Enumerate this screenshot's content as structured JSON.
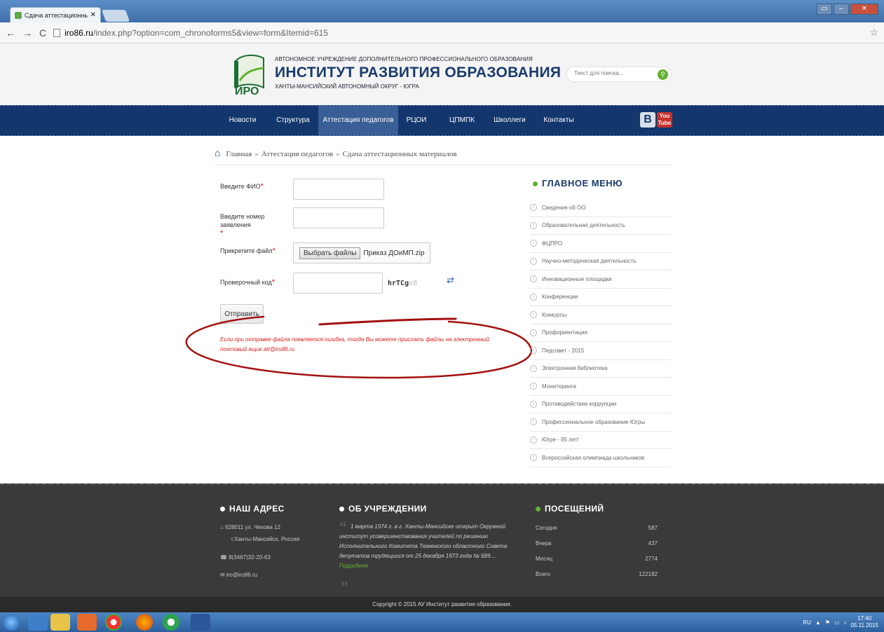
{
  "browser": {
    "tab_title": "Сдача аттестационных м",
    "url_host": "iro86.ru",
    "url_path": "/index.php?option=com_chronoforms5&view=form&Itemid=615"
  },
  "header": {
    "logo_text": "ИРО",
    "org_sub": "АВТОНОМНОЕ УЧРЕЖДЕНИЕ ДОПОЛНИТЕЛЬНОГО ПРОФЕССИОНАЛЬНОГО ОБРАЗОВАНИЯ",
    "org_title": "ИНСТИТУТ РАЗВИТИЯ ОБРАЗОВАНИЯ",
    "org_region": "ХАНТЫ-МАНСИЙСКИЙ АВТОНОМНЫЙ ОКРУГ - ЮГРА",
    "search_placeholder": "Текст для поиска..."
  },
  "nav": {
    "items": [
      {
        "label": "Новости"
      },
      {
        "label": "Структура"
      },
      {
        "label": "Аттестация педагогов"
      },
      {
        "label": "РЦОИ"
      },
      {
        "label": "ЦПМПК"
      },
      {
        "label": "Школлеги"
      },
      {
        "label": "Контакты"
      }
    ],
    "vk_label": "B",
    "yt_label_top": "You",
    "yt_label_bottom": "Tube"
  },
  "breadcrumb": {
    "home": "Главная",
    "sep": "»",
    "level1": "Аттестация педагогов",
    "current": "Сдача аттестационных материалов"
  },
  "form": {
    "label_fio": "Введите ФИО",
    "label_app": "Введите номер заявления",
    "label_file": "Прикрепите файл",
    "label_captcha": "Проверочный код",
    "required_mark": "*",
    "file_button": "Выбрать файлы",
    "file_name": "Приказ ДОиМП.zip",
    "captcha_text": "hrTCg",
    "captcha_faint": "x8",
    "submit": "Отправить",
    "note": "Если при отправке файла появляется ошибка, тогда Вы можете прислать файлы на электронный почтовый ящик att@iro86.ru"
  },
  "sidebar": {
    "title": "ГЛАВНОЕ МЕНЮ",
    "items": [
      "Сведения об ОО",
      "Образовательная деятельность",
      "ФЦПРО",
      "Научно-методическая деятельность",
      "Инновационные площадки",
      "Конференции",
      "Конкурсы",
      "Профориентация",
      "Педсовет - 2015",
      "Электронная библиотека",
      "Мониторинги",
      "Противодействие коррупции",
      "Профессиональное образование Югры",
      "Югре - 85 лет!",
      "Всероссийская олимпиада школьников"
    ]
  },
  "footer": {
    "address_title": "НАШ АДРЕС",
    "address_line1": "628011 ул. Чехова 12",
    "address_line2": "г.Ханты-Мансийск, Россия",
    "phone": "8(3467)32-20-63",
    "email": "iro@iro86.ru",
    "about_title": "ОБ УЧРЕЖДЕНИИ",
    "about_text": "1 марта 1974 г. в г. Ханты-Мансийске открыт Окружной институт усовершенствования учителей по решению Исполнительного Комитета Тюменского областного Совета депутатов трудящихся от 25 декабря 1973 года № 689....",
    "about_more": "Подробнее",
    "visits_title": "ПОСЕЩЕНИЙ",
    "visits": [
      {
        "label": "Сегодня",
        "value": "587"
      },
      {
        "label": "Вчера",
        "value": "437"
      },
      {
        "label": "Месяц",
        "value": "2774"
      },
      {
        "label": "Всего",
        "value": "122182"
      }
    ],
    "copyright": "Copyright © 2015 АУ Институт развития образования."
  },
  "taskbar": {
    "lang": "RU",
    "time": "17:40",
    "date": "05.11.2015"
  },
  "colors": {
    "nav_bg": "#13366d",
    "accent_green": "#62b22f",
    "title_blue": "#1a3b6e",
    "note_red": "#d41c1c",
    "annotation_red": "#a31010"
  }
}
